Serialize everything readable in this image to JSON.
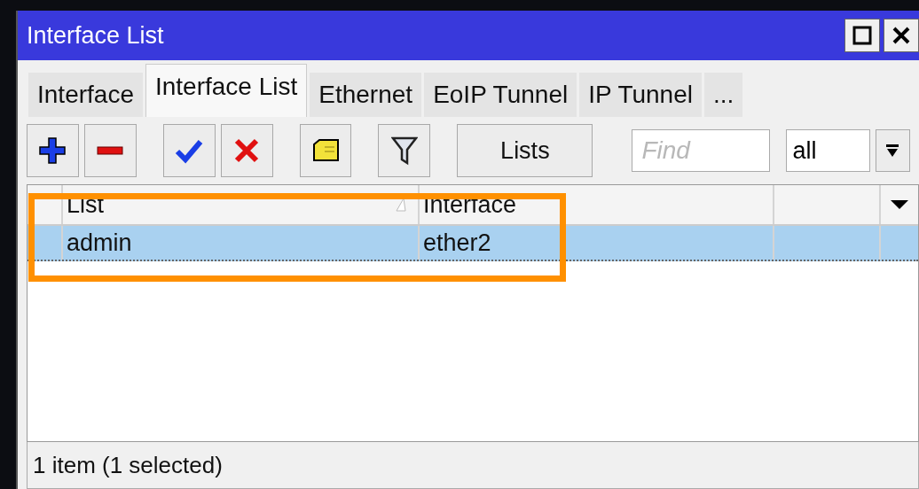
{
  "window": {
    "title": "Interface List"
  },
  "tabs": [
    {
      "label": "Interface",
      "selected": false
    },
    {
      "label": "Interface List",
      "selected": true
    },
    {
      "label": "Ethernet",
      "selected": false
    },
    {
      "label": "EoIP Tunnel",
      "selected": false
    },
    {
      "label": "IP Tunnel",
      "selected": false
    },
    {
      "label": "...",
      "selected": false
    }
  ],
  "toolbar": {
    "buttons": [
      {
        "kind": "add"
      },
      {
        "kind": "remove"
      },
      {
        "kind": "enable"
      },
      {
        "kind": "disable"
      },
      {
        "kind": "comment"
      },
      {
        "kind": "filter"
      }
    ],
    "lists_button": "Lists",
    "find": {
      "placeholder": "Find"
    },
    "filter_select": {
      "value": "all"
    }
  },
  "table": {
    "columns": [
      "List",
      "Interface"
    ],
    "rows": [
      {
        "cells": [
          "admin",
          "ether2"
        ],
        "selected": true
      }
    ]
  },
  "status_bar": "1 item (1 selected)"
}
